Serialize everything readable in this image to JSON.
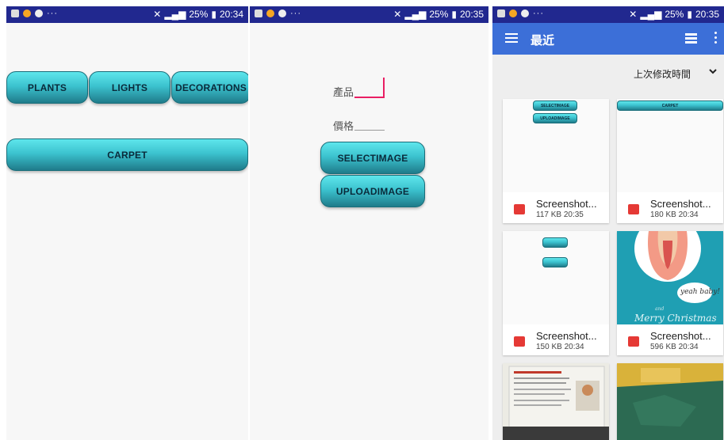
{
  "screens": [
    {
      "status": {
        "battery": "25%",
        "time": "20:34"
      },
      "buttons": {
        "plants": "PLANTS",
        "lights": "LIGHTS",
        "decorations": "DECORATIONS",
        "carpet": "CARPET"
      }
    },
    {
      "status": {
        "battery": "25%",
        "time": "20:35"
      },
      "form": {
        "product_label": "產品",
        "price_label": "價格",
        "select_image": "SELECTIMAGE",
        "upload_image": "UPLOADIMAGE"
      }
    },
    {
      "status": {
        "battery": "25%",
        "time": "20:35"
      },
      "appbar": {
        "title": "最近"
      },
      "sort": {
        "label": "上次修改時間"
      },
      "files": [
        {
          "name": "Screenshot...",
          "meta": "117 KB 20:35",
          "thumb_buttons": [
            "SELECTIMAGE",
            "UPLOADIMAGE"
          ]
        },
        {
          "name": "Screenshot...",
          "meta": "180 KB 20:34",
          "thumb_buttons": [
            "CARPET"
          ]
        },
        {
          "name": "Screenshot...",
          "meta": "150 KB 20:34"
        },
        {
          "name": "Screenshot...",
          "meta": "596 KB 20:34",
          "thumb_texts": [
            "yeah baby!",
            "and",
            "Merry Christmas"
          ]
        }
      ]
    }
  ],
  "colors": {
    "status_bar": "#21288f",
    "app_bar": "#3c6fd8",
    "button_top": "#5ee6ec",
    "button_bottom": "#1f7b8a",
    "field_focus": "#e91e63",
    "image_icon": "#e53935"
  }
}
